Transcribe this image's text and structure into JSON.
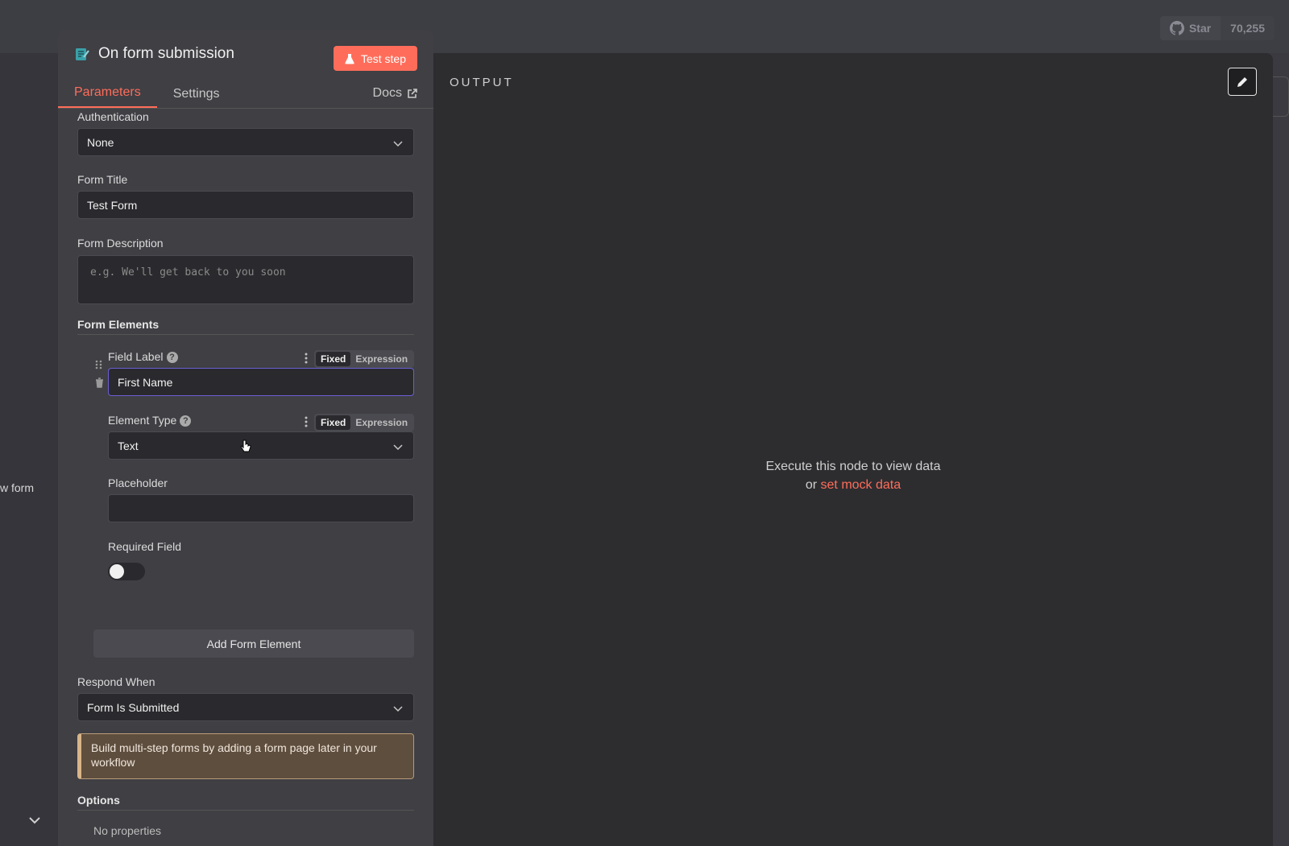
{
  "background": {
    "left_text_1": "w form",
    "left_text_2": "",
    "github": {
      "star_label": "Star",
      "star_count": "70,255"
    }
  },
  "node_panel": {
    "title": "On form submission",
    "test_button": "Test step",
    "tabs": [
      {
        "label": "Parameters",
        "active": true
      },
      {
        "label": "Settings",
        "active": false
      }
    ],
    "docs_label": "Docs",
    "authentication": {
      "label": "Authentication",
      "value": "None"
    },
    "form_title": {
      "label": "Form Title",
      "value": "Test Form"
    },
    "form_description": {
      "label": "Form Description",
      "placeholder": "e.g. We'll get back to you soon"
    },
    "form_elements": {
      "title": "Form Elements",
      "field_label": {
        "label": "Field Label",
        "value": "First Name"
      },
      "element_type": {
        "label": "Element Type",
        "value": "Text"
      },
      "mode_fixed": "Fixed",
      "mode_expression": "Expression",
      "placeholder": {
        "label": "Placeholder",
        "value": ""
      },
      "required": {
        "label": "Required Field",
        "enabled": false
      },
      "add_button": "Add Form Element"
    },
    "respond_when": {
      "label": "Respond When",
      "value": "Form Is Submitted"
    },
    "notice": "Build multi-step forms by adding a form page later in your workflow",
    "options": {
      "title": "Options",
      "empty": "No properties"
    }
  },
  "output_panel": {
    "title": "OUTPUT",
    "empty_line1": "Execute this node to view data",
    "empty_or": "or",
    "mock_link": "set mock data"
  },
  "colors": {
    "accent": "#ff6d5a",
    "panel": "#3f3f44",
    "output": "#2d2d30"
  }
}
